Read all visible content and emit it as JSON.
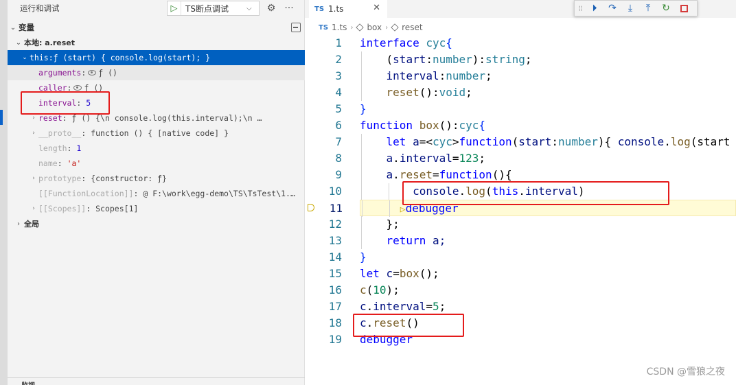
{
  "left_panel": {
    "title": "运行和调试",
    "launch_config": "TS断点调试",
    "variables_section": "变量",
    "local_scope": "本地: a.reset",
    "rows": [
      {
        "key": "this",
        "value": "ƒ (start) { console.log(start); }"
      },
      {
        "key": "arguments",
        "value": "ƒ ()"
      },
      {
        "key": "caller",
        "value": "ƒ ()"
      },
      {
        "key": "interval",
        "value": "5"
      },
      {
        "key": "reset",
        "value": "ƒ () {\\n        console.log(this.interval);\\n …"
      },
      {
        "key": "__proto__",
        "value": "function () { [native code] }"
      },
      {
        "key": "length",
        "value": "1"
      },
      {
        "key": "name",
        "value": "'a'"
      },
      {
        "key": "prototype",
        "value": "{constructor: ƒ}"
      },
      {
        "key": "[[FunctionLocation]]",
        "value": "@ F:\\work\\egg-demo\\TS\\TsTest\\1.…"
      },
      {
        "key": "[[Scopes]]",
        "value": "Scopes[1]"
      }
    ],
    "global_scope": "全局",
    "watch_section": "监视"
  },
  "editor": {
    "tab_badge": "TS",
    "tab_name": "1.ts",
    "breadcrumb": [
      "1.ts",
      "box",
      "reset"
    ],
    "current_line": 11,
    "watermark": "CSDN @雪狼之夜",
    "lines": [
      {
        "n": "1"
      },
      {
        "n": "2"
      },
      {
        "n": "3"
      },
      {
        "n": "4"
      },
      {
        "n": "5"
      },
      {
        "n": "6"
      },
      {
        "n": "7"
      },
      {
        "n": "8"
      },
      {
        "n": "9"
      },
      {
        "n": "10"
      },
      {
        "n": "11"
      },
      {
        "n": "12"
      },
      {
        "n": "13"
      },
      {
        "n": "14"
      },
      {
        "n": "15"
      },
      {
        "n": "16"
      },
      {
        "n": "17"
      },
      {
        "n": "18"
      },
      {
        "n": "19"
      }
    ],
    "tokens": {
      "interface": "interface",
      "cyc": "cyc",
      "ob": "{",
      "cb": "}",
      "l2a": "(",
      "start": "start",
      "colon": ":",
      "number": "number",
      "l2b": "):",
      "string": "string",
      "semi": ";",
      "interval": "interval",
      "reset": "reset",
      "paren": "()",
      "void": "void",
      "function": "function",
      "box": "box",
      "let": "let",
      "a": "a",
      "l7a": "=<",
      "l7b": ">",
      "l7c": "(",
      "l7d": "){ ",
      "console": "console",
      "dot": ".",
      "log": "log",
      "l7e": "(start",
      "eq": "=",
      "n123": "123",
      "l9a": "(){",
      "this": "this",
      "l10a": "(",
      "l10b": ".",
      "l10c": ")",
      "debugger": "debugger",
      "l12": "};",
      "return": "return",
      "a_semi": "a;",
      "c": "c",
      "l15a": "()",
      "n10": "10",
      "n5": "5"
    }
  }
}
